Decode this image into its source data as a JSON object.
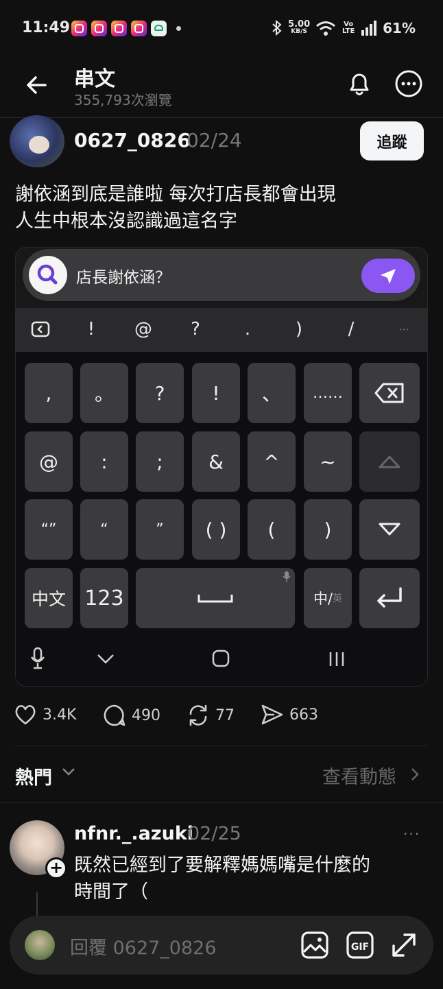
{
  "status": {
    "time": "11:49",
    "net_speed_value": "5.00",
    "net_speed_unit": "KB/S",
    "volte": "Vo LTE",
    "battery": "61%"
  },
  "header": {
    "title": "串文",
    "views": "355,793次瀏覽"
  },
  "post": {
    "username": "0627_0826",
    "date": "02/24",
    "follow_label": "追蹤",
    "text_line1": "謝依涵到底是誰啦 每次打店長都會出現",
    "text_line2": "人生中根本沒認識過這名字"
  },
  "screenshot": {
    "search_text": "店長謝依涵？",
    "symbol_row": [
      "!",
      "@",
      "?",
      ".",
      ")",
      "/",
      "···"
    ],
    "keys_row1": [
      ",",
      "。",
      "?",
      "!",
      "、",
      "……"
    ],
    "keys_row2": [
      "@",
      ":",
      ";",
      "&",
      "^",
      "~"
    ],
    "keys_row3": [
      "“”",
      "“",
      "”",
      "( )",
      "(",
      ")"
    ],
    "key_chinese": "中文",
    "key_123": "123",
    "key_lang": "中/",
    "key_lang_sub": "英"
  },
  "actions": {
    "likes": "3.4K",
    "comments": "490",
    "reposts": "77",
    "shares": "663"
  },
  "section": {
    "hot_label": "熱門",
    "activity_label": "查看動態"
  },
  "comment": {
    "username": "nfnr._.azuki",
    "date": "02/25",
    "more": "···",
    "text_line1": "既然已經到了要解釋媽媽嘴是什麼的",
    "text_line2": "時間了（"
  },
  "reply": {
    "placeholder": "回覆 0627_0826"
  },
  "colors": {
    "background": "#101010",
    "accent_purple": "#8b57f2",
    "text_primary": "#f3f5f7",
    "text_secondary": "#777777"
  },
  "icons": [
    "back-arrow-icon",
    "bell-icon",
    "more-icon",
    "heart-icon",
    "comment-icon",
    "repost-icon",
    "share-icon",
    "chevron-down-icon",
    "chevron-right-icon",
    "image-icon",
    "gif-icon",
    "expand-icon"
  ]
}
